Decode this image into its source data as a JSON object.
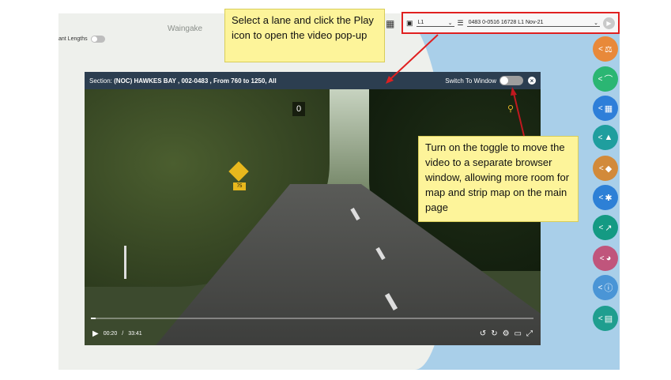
{
  "map": {
    "place_label": "Waingake"
  },
  "segment_toggle": {
    "label": "ant Lengths"
  },
  "selection_bar": {
    "lane_value": "L1",
    "section_value": "0483 0-0516 16728 L1 Nov-21"
  },
  "callouts": {
    "top": "Select a lane and click the Play icon to open the video pop-up",
    "right": "Turn on the toggle to move the video to a separate browser window, allowing more room for map and strip map on the main page"
  },
  "video": {
    "section_label": "Section:",
    "section_text": "(NOC) HAWKES BAY , 002-0483 , From 760 to 1250, All",
    "switch_label": "Switch To Window",
    "frame_number": "0",
    "sign_speed": "75",
    "time_current": "00:20",
    "time_sep": "/",
    "time_total": "33:41",
    "progress": 0.01
  },
  "tools": [
    {
      "name": "tool-measure",
      "icon": "ruler-icon",
      "glyph": "⚖",
      "color": "#e8893a"
    },
    {
      "name": "tool-chart",
      "icon": "chart-icon",
      "glyph": "⌒",
      "color": "#2bb673"
    },
    {
      "name": "tool-table",
      "icon": "table-icon",
      "glyph": "▦",
      "color": "#2e7fd9"
    },
    {
      "name": "tool-road",
      "icon": "road-icon",
      "glyph": "▲",
      "color": "#1f9e9e"
    },
    {
      "name": "tool-condition",
      "icon": "condition-icon",
      "glyph": "◆",
      "color": "#d28a3a"
    },
    {
      "name": "tool-treatment",
      "icon": "treatment-icon",
      "glyph": "✱",
      "color": "#2d80d6"
    },
    {
      "name": "tool-trend",
      "icon": "trend-icon",
      "glyph": "↗",
      "color": "#149a83"
    },
    {
      "name": "tool-pie",
      "icon": "pie-icon",
      "glyph": "◕",
      "color": "#c0557c"
    },
    {
      "name": "tool-info",
      "icon": "info-icon",
      "glyph": "ⓘ",
      "color": "#4a95d6"
    },
    {
      "name": "tool-report",
      "icon": "report-icon",
      "glyph": "▤",
      "color": "#1f9e8f"
    }
  ]
}
